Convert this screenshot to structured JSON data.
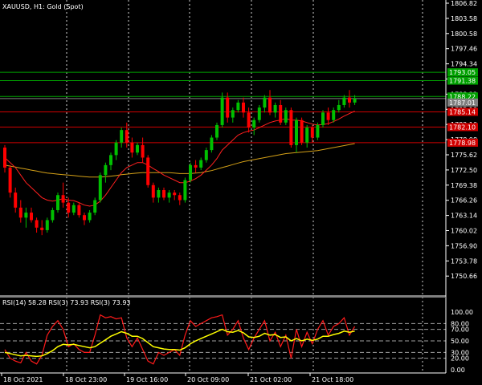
{
  "header": {
    "symbol_label": "XAUUSD, H1:  Gold (Spot)",
    "rsi_label": "RSI(14) 58.28 RSI(3) 73.93 RSI(3) 73.93"
  },
  "colors": {
    "background": "#000000",
    "bull_candle": "#00c000",
    "bear_candle": "#ff0000",
    "ma_fast": "#ff2020",
    "ma_slow": "#d4a017",
    "rsi_fast": "#ff1a1a",
    "rsi_slow": "#ffff00",
    "level_green": "#00a000",
    "level_red": "#d00000",
    "grid": "#d0d0d0"
  },
  "price_axis": {
    "labels": [
      "1806.82",
      "1803.58",
      "1800.58",
      "1797.46",
      "1794.34",
      "1791.22",
      "1788.22",
      "1785.10",
      "1782.10",
      "1778.98",
      "1775.62",
      "1772.50",
      "1769.38",
      "1766.26",
      "1763.14",
      "1760.02",
      "1756.90",
      "1753.78",
      "1750.66"
    ],
    "rsi_labels": [
      "100.00",
      "80.00",
      "70.00",
      "50.00",
      "30.00",
      "20.00",
      "0.00"
    ]
  },
  "level_tags": [
    {
      "text": "1793.05",
      "color": "#00a000"
    },
    {
      "text": "1791.38",
      "color": "#00a000"
    },
    {
      "text": "1788.22",
      "color": "#00a000"
    },
    {
      "text": "1787.01",
      "color": "#808080"
    },
    {
      "text": "1785.14",
      "color": "#d00000"
    },
    {
      "text": "1782.10",
      "color": "#d00000"
    },
    {
      "text": "1778.98",
      "color": "#d00000"
    }
  ],
  "time_axis": {
    "labels": [
      "18 Oct 2021",
      "18 Oct 23:00",
      "19 Oct 16:00",
      "20 Oct 09:00",
      "21 Oct 02:00",
      "21 Oct 18:00"
    ]
  },
  "chart_data": {
    "type": "candlestick",
    "title": "XAUUSD, H1: Gold (Spot)",
    "ylim": [
      1748.5,
      1807.5
    ],
    "candles": [
      [
        1778,
        1778.5,
        1773,
        1774
      ],
      [
        1774,
        1774.5,
        1768,
        1769
      ],
      [
        1769,
        1770,
        1765,
        1766
      ],
      [
        1766,
        1767.5,
        1763,
        1764
      ],
      [
        1764,
        1766,
        1762,
        1765
      ],
      [
        1765,
        1766,
        1763,
        1763.5
      ],
      [
        1763.5,
        1764,
        1761,
        1762
      ],
      [
        1762,
        1763.5,
        1760.5,
        1761.5
      ],
      [
        1761.5,
        1764,
        1761,
        1763.5
      ],
      [
        1763.5,
        1766,
        1763,
        1765.5
      ],
      [
        1765.5,
        1769,
        1765,
        1768.5
      ],
      [
        1768.5,
        1771,
        1766,
        1767
      ],
      [
        1767,
        1768,
        1764,
        1765
      ],
      [
        1765,
        1767,
        1764.5,
        1766.5
      ],
      [
        1766.5,
        1767,
        1764,
        1764.5
      ],
      [
        1764.5,
        1765,
        1762.5,
        1763.5
      ],
      [
        1763.5,
        1765.5,
        1763,
        1765
      ],
      [
        1765,
        1768,
        1764.5,
        1767.5
      ],
      [
        1767.5,
        1773,
        1767,
        1772.5
      ],
      [
        1772.5,
        1775,
        1771,
        1774.5
      ],
      [
        1774.5,
        1777,
        1773.5,
        1776.5
      ],
      [
        1776.5,
        1779.5,
        1775.5,
        1779
      ],
      [
        1779,
        1782,
        1778,
        1781.5
      ],
      [
        1781.5,
        1783,
        1778,
        1779
      ],
      [
        1779,
        1780,
        1776,
        1777
      ],
      [
        1777,
        1779,
        1776.5,
        1778.5
      ],
      [
        1778.5,
        1780,
        1775,
        1776
      ],
      [
        1776,
        1776.5,
        1770,
        1770.5
      ],
      [
        1770.5,
        1771,
        1767,
        1768
      ],
      [
        1768,
        1770,
        1767,
        1769.5
      ],
      [
        1769.5,
        1770,
        1767.5,
        1768
      ],
      [
        1768,
        1769.5,
        1767,
        1769
      ],
      [
        1769,
        1769.5,
        1767.5,
        1768.5
      ],
      [
        1768.5,
        1769,
        1766.5,
        1767.5
      ],
      [
        1767.5,
        1772,
        1767,
        1771.5
      ],
      [
        1771.5,
        1775,
        1771,
        1774.5
      ],
      [
        1774.5,
        1775.5,
        1773,
        1774
      ],
      [
        1774,
        1776,
        1773.5,
        1775.5
      ],
      [
        1775.5,
        1778,
        1775,
        1777.5
      ],
      [
        1777.5,
        1780.5,
        1777,
        1780
      ],
      [
        1780,
        1783,
        1779.5,
        1782.5
      ],
      [
        1782.5,
        1789,
        1782,
        1788
      ],
      [
        1788,
        1789,
        1783,
        1784
      ],
      [
        1784,
        1786,
        1783,
        1785.5
      ],
      [
        1785.5,
        1787.5,
        1785,
        1787
      ],
      [
        1787,
        1788,
        1784,
        1785
      ],
      [
        1785,
        1786,
        1781,
        1782
      ],
      [
        1782,
        1784,
        1780.5,
        1783.5
      ],
      [
        1783.5,
        1786.5,
        1783,
        1786
      ],
      [
        1786,
        1788.5,
        1785,
        1788
      ],
      [
        1788,
        1789.5,
        1784.5,
        1785
      ],
      [
        1785,
        1787,
        1784,
        1786.5
      ],
      [
        1786.5,
        1787.5,
        1782.5,
        1783
      ],
      [
        1783,
        1786,
        1782.5,
        1785.5
      ],
      [
        1785.5,
        1786,
        1778,
        1778.5
      ],
      [
        1778.5,
        1784,
        1777,
        1783.5
      ],
      [
        1783.5,
        1784,
        1778.5,
        1779
      ],
      [
        1779,
        1782.5,
        1778,
        1782
      ],
      [
        1782,
        1782.5,
        1779,
        1780
      ],
      [
        1780,
        1783,
        1779.5,
        1782.5
      ],
      [
        1782.5,
        1785.5,
        1782,
        1785
      ],
      [
        1785,
        1786,
        1782.5,
        1783.5
      ],
      [
        1783.5,
        1786,
        1783,
        1785.5
      ],
      [
        1785.5,
        1787.5,
        1785,
        1786.5
      ],
      [
        1786.5,
        1788.5,
        1786,
        1788
      ],
      [
        1788,
        1789.5,
        1786,
        1787
      ],
      [
        1787,
        1788.5,
        1786.5,
        1787.8
      ]
    ],
    "ma_fast": [
      1776,
      1775,
      1774,
      1772.5,
      1771,
      1770,
      1769,
      1768,
      1767.5,
      1767.3,
      1767.5,
      1767.8,
      1767.5,
      1767.4,
      1767,
      1766.5,
      1766.3,
      1766.5,
      1767.3,
      1768.5,
      1770,
      1771.5,
      1773,
      1774,
      1774.5,
      1775,
      1775,
      1774.5,
      1773.8,
      1773.2,
      1772.5,
      1772,
      1771.5,
      1771,
      1771,
      1771.3,
      1771.8,
      1772.5,
      1773.5,
      1774.5,
      1775.8,
      1777.5,
      1778.5,
      1779.5,
      1780.5,
      1781,
      1781.3,
      1781.5,
      1782,
      1782.5,
      1783,
      1783.3,
      1783.5,
      1783.8,
      1783.5,
      1783.5,
      1783.3,
      1783,
      1782.7,
      1782.5,
      1782.6,
      1782.8,
      1783.2,
      1783.7,
      1784.3,
      1784.8,
      1785.3
    ],
    "ma_slow": [
      1774.5,
      1774.3,
      1774.1,
      1773.9,
      1773.7,
      1773.5,
      1773.3,
      1773.1,
      1772.9,
      1772.8,
      1772.7,
      1772.6,
      1772.5,
      1772.4,
      1772.3,
      1772.2,
      1772.1,
      1772.1,
      1772.1,
      1772.2,
      1772.3,
      1772.4,
      1772.6,
      1772.7,
      1772.8,
      1772.9,
      1773,
      1773,
      1773,
      1773,
      1773,
      1773,
      1772.9,
      1772.8,
      1772.8,
      1772.8,
      1772.9,
      1773,
      1773.2,
      1773.4,
      1773.7,
      1774,
      1774.3,
      1774.6,
      1774.9,
      1775.2,
      1775.4,
      1775.6,
      1775.8,
      1776,
      1776.2,
      1776.4,
      1776.6,
      1776.8,
      1776.9,
      1777,
      1777.1,
      1777.2,
      1777.3,
      1777.4,
      1777.6,
      1777.8,
      1778,
      1778.2,
      1778.4,
      1778.6,
      1778.8
    ],
    "rsi_fast": [
      35,
      20,
      15,
      12,
      30,
      15,
      10,
      25,
      60,
      75,
      85,
      70,
      40,
      45,
      35,
      30,
      30,
      60,
      95,
      90,
      92,
      88,
      90,
      55,
      40,
      55,
      35,
      15,
      10,
      30,
      25,
      30,
      35,
      25,
      60,
      85,
      75,
      80,
      85,
      90,
      92,
      95,
      60,
      70,
      85,
      55,
      35,
      55,
      70,
      85,
      50,
      65,
      40,
      60,
      20,
      70,
      40,
      65,
      45,
      70,
      85,
      60,
      75,
      80,
      90,
      60,
      75
    ],
    "rsi_slow": [
      30,
      28,
      26,
      24,
      25,
      24,
      23,
      24,
      28,
      33,
      40,
      44,
      43,
      44,
      42,
      40,
      38,
      40,
      46,
      52,
      58,
      62,
      66,
      63,
      58,
      58,
      54,
      47,
      40,
      38,
      36,
      35,
      35,
      34,
      38,
      45,
      50,
      54,
      58,
      62,
      66,
      70,
      66,
      65,
      68,
      64,
      57,
      56,
      58,
      63,
      60,
      61,
      56,
      57,
      50,
      54,
      50,
      53,
      51,
      53,
      58,
      58,
      61,
      63,
      67,
      65,
      67
    ],
    "horizontal_levels": [
      {
        "value": 1793.05,
        "color": "green"
      },
      {
        "value": 1791.38,
        "color": "green"
      },
      {
        "value": 1788.22,
        "color": "green"
      },
      {
        "value": 1785.14,
        "color": "red"
      },
      {
        "value": 1782.1,
        "color": "red"
      },
      {
        "value": 1778.98,
        "color": "red"
      }
    ],
    "rsi_levels": [
      80,
      70,
      50,
      30,
      20
    ],
    "rsi_ylim": [
      0,
      100
    ]
  }
}
